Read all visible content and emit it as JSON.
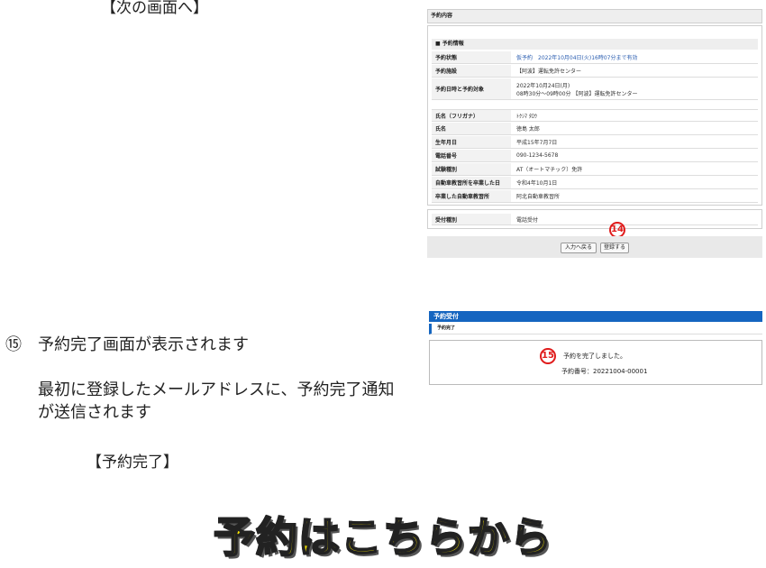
{
  "labels": {
    "next_screen": "【次の画面へ】",
    "step15_num": "⑮",
    "step15_title": "予約完了画面が表示されます",
    "step15_desc": "最初に登録したメールアドレスに、予約完了通知が送信されます",
    "complete_screen": "【予約完了】",
    "banner": "予約はこちらから"
  },
  "form": {
    "header": "予約内容",
    "section": "■ 予約情報",
    "rows": [
      {
        "key": "予約状態",
        "value": "仮予約　2022年10月04日(火)16時07分まで有効"
      },
      {
        "key": "予約施設",
        "value": "【阿波】運転免許センター"
      },
      {
        "key": "予約日時と予約対象",
        "value": "2022年10月24日(月)",
        "value2": "08時30分～09時00分 【阿波】運転免許センター"
      },
      {
        "key": "氏名（フリガナ）",
        "value": "ﾄｸｼﾏ ﾀﾛｳ"
      },
      {
        "key": "氏名",
        "value": "徳島 太郎"
      },
      {
        "key": "生年月日",
        "value": "平成15年7月7日"
      },
      {
        "key": "電話番号",
        "value": "090-1234-5678"
      },
      {
        "key": "試験種別",
        "value": "AT（オートマチック）免許"
      },
      {
        "key": "自動車教習所を卒業した日",
        "value": "令和4年10月1日"
      },
      {
        "key": "卒業した自動車教習所",
        "value": "阿北自動車教習所"
      }
    ],
    "accept_key": "受付種別",
    "accept_value": "電話受付",
    "btn_back": "入力へ戻る",
    "btn_register": "登録する",
    "marker": "14"
  },
  "complete": {
    "header": "予約受付",
    "sub": "予約完了",
    "message": "予約を完了しました。",
    "number": "予約番号：20221004-00001",
    "marker": "15"
  }
}
